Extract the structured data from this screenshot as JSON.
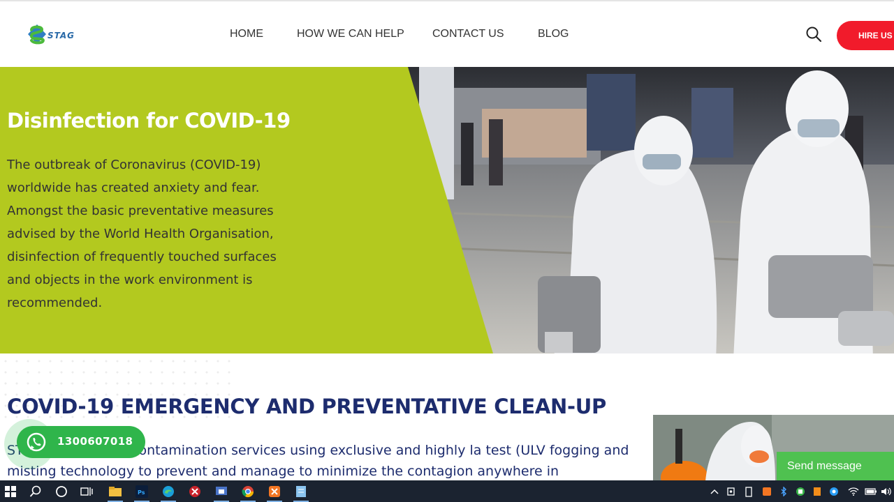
{
  "header": {
    "logo_text": "STAG",
    "nav": [
      {
        "label": "HOME"
      },
      {
        "label": "HOW WE CAN HELP"
      },
      {
        "label": "CONTACT US"
      },
      {
        "label": "BLOG"
      }
    ],
    "search_icon": "search-icon",
    "hire_label": "HIRE US N"
  },
  "hero": {
    "title": "Disinfection for COVID-19",
    "text": "The outbreak of Coronavirus (COVID-19) worldwide has created anxiety and fear. Amongst the basic preventative measures advised by the World Health Organisation, disinfection of frequently touched surfaces and objects in the work environment is recommended.",
    "accent_color": "#b3c91f"
  },
  "section": {
    "title": "COVID-19 EMERGENCY AND PREVENTATIVE CLEAN-UP",
    "text": "ST… emendous decontamination services using exclusive and highly la test (ULV fogging and misting technology to prevent and manage to minimize the contagion anywhere in"
  },
  "whatsapp": {
    "phone": "1300607018",
    "icon": "whatsapp-icon"
  },
  "chat": {
    "send_label": "Send message"
  },
  "taskbar": {
    "icons": [
      "windows-start-icon",
      "search-icon",
      "cortana-icon",
      "task-view-icon",
      "file-explorer-icon",
      "photoshop-icon",
      "edge-icon",
      "app-icon",
      "remote-app-icon",
      "chrome-icon",
      "xampp-icon",
      "notepad-icon"
    ],
    "tray_icons": [
      "chevron-up-icon",
      "meet-icon",
      "battery-status-icon",
      "xampp-tray-icon",
      "bluetooth-icon",
      "network-app-icon",
      "office-icon",
      "sync-icon",
      "wifi-icon",
      "battery-icon",
      "volume-icon"
    ]
  }
}
